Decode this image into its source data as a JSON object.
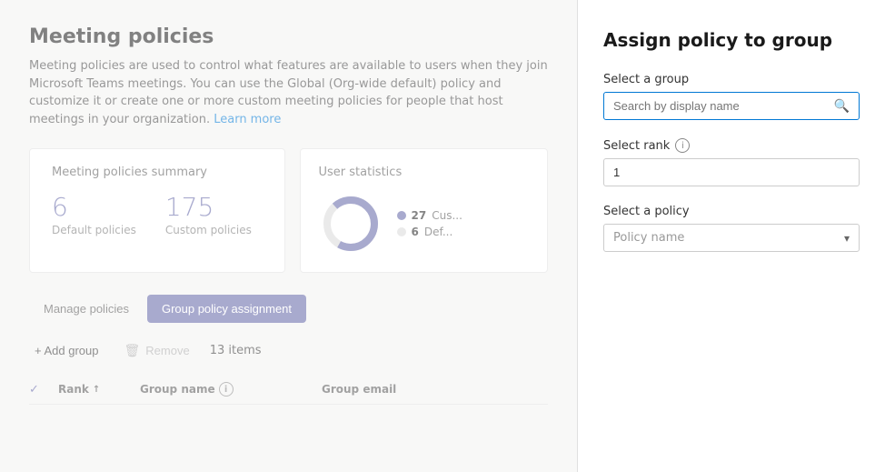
{
  "page": {
    "title": "Meeting policies",
    "description": "Meeting policies are used to control what features are available to users when they join Microsoft Teams meetings. You can use the Global (Org-wide default) policy and customize it or create one or more custom meeting policies for people that host meetings in your organization.",
    "learn_more": "Learn more"
  },
  "summary_card": {
    "title": "Meeting policies summary",
    "default_count": "6",
    "default_label": "Default policies",
    "custom_count": "175",
    "custom_label": "Custom policies"
  },
  "user_stats": {
    "title": "User statistics",
    "custom_count": "27",
    "custom_label": "Cus...",
    "default_count": "6",
    "default_label": "Def..."
  },
  "tabs": [
    {
      "id": "manage",
      "label": "Manage policies",
      "active": false
    },
    {
      "id": "group",
      "label": "Group policy assignment",
      "active": true
    }
  ],
  "toolbar": {
    "add_label": "+ Add group",
    "remove_label": "Remove",
    "items_count": "13 items"
  },
  "table": {
    "columns": [
      {
        "id": "rank",
        "label": "Rank"
      },
      {
        "id": "group_name",
        "label": "Group name"
      },
      {
        "id": "group_email",
        "label": "Group email"
      }
    ]
  },
  "side_panel": {
    "title": "Assign policy to group",
    "select_group_label": "Select a group",
    "search_placeholder": "Search by display name",
    "select_rank_label": "Select rank",
    "rank_value": "1",
    "select_policy_label": "Select a policy",
    "policy_placeholder": "Policy name"
  },
  "colors": {
    "accent": "#6264a7",
    "blue": "#0078d4",
    "donut_custom": "#6264a7",
    "donut_default": "#d9d9d9"
  }
}
